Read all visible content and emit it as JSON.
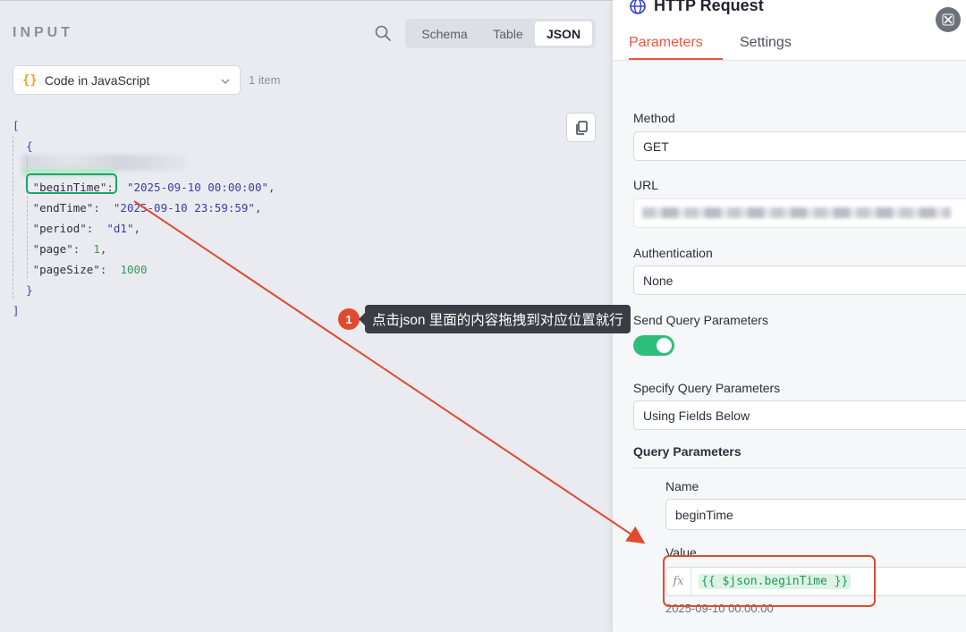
{
  "input_panel": {
    "title": "INPUT",
    "view_tabs": [
      "Schema",
      "Table",
      "JSON"
    ],
    "active_view": "JSON",
    "node_selector": "Code in JavaScript",
    "item_count": "1 item",
    "json_lines": [
      {
        "key": "beginTime",
        "value": "\"2025-09-10 00:00:00\"",
        "type": "str"
      },
      {
        "key": "endTime",
        "value": "\"2025-09-10 23:59:59\"",
        "type": "str"
      },
      {
        "key": "period",
        "value": "\"d1\"",
        "type": "str"
      },
      {
        "key": "page",
        "value": "1",
        "type": "num"
      },
      {
        "key": "pageSize",
        "value": "1000",
        "type": "num"
      }
    ]
  },
  "callout": {
    "number": "1",
    "text": "点击json 里面的内容拖拽到对应位置就行"
  },
  "node_panel": {
    "title": "HTTP Request",
    "tabs": {
      "parameters": "Parameters",
      "settings": "Settings"
    },
    "method": {
      "label": "Method",
      "value": "GET"
    },
    "url": {
      "label": "URL"
    },
    "authentication": {
      "label": "Authentication",
      "value": "None"
    },
    "send_query": {
      "label": "Send Query Parameters",
      "enabled": true
    },
    "specify_query": {
      "label": "Specify Query Parameters",
      "value": "Using Fields Below"
    },
    "query_parameters": {
      "title": "Query Parameters",
      "name_label": "Name",
      "name_value": "beginTime",
      "value_label": "Value",
      "value_expression": "{{ $json.beginTime }}",
      "value_result": "2025-09-10 00:00:00"
    }
  },
  "colors": {
    "accent": "#e8563f",
    "toggle_on": "#2dbf7a",
    "highlight_green": "#1ea36a",
    "annotation_red": "#e24a2d"
  }
}
